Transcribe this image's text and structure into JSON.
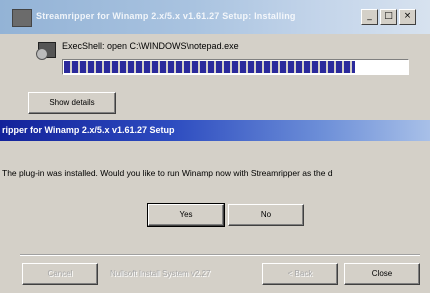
{
  "installer": {
    "title": "Streamripper for Winamp 2.x/5.x v1.61.27 Setup: Installing",
    "window_buttons": [
      "_",
      "□",
      "×"
    ],
    "status": "ExecShell: open C:\\WINDOWS\\notepad.exe",
    "progress": 0.85,
    "show_details_label": "Show details",
    "footer": {
      "cancel_label": "Cancel",
      "branding": "Nullsoft Install System v2.27",
      "back_label": "< Back",
      "close_label": "Close"
    }
  },
  "dialog": {
    "title": "ripper for Winamp 2.x/5.x v1.61.27 Setup",
    "message": "The plug-in was installed. Would you like to run Winamp now with Streamripper as the d",
    "yes_label": "Yes",
    "no_label": "No"
  }
}
